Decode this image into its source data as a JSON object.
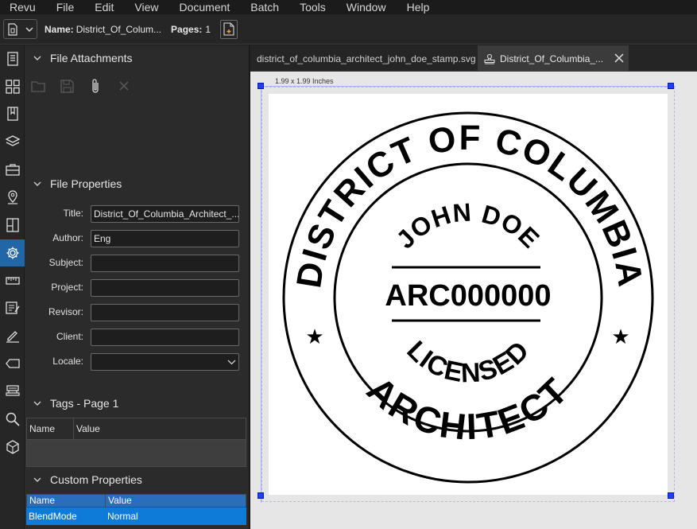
{
  "menu": [
    "Revu",
    "File",
    "Edit",
    "View",
    "Document",
    "Batch",
    "Tools",
    "Window",
    "Help"
  ],
  "toolbar": {
    "name_label": "Name:",
    "name_value": "District_Of_Colum...",
    "pages_label": "Pages:",
    "pages_value": "1"
  },
  "rail_icons": [
    "thumbnails-icon",
    "grid-icon",
    "bookmarks-icon",
    "layers-icon",
    "toolchest-icon",
    "places-icon",
    "measure-icon",
    "properties-icon",
    "ruler-icon",
    "markups-list-icon",
    "signature-icon",
    "tag-icon",
    "stamp-icon",
    "search-icon",
    "3d-icon"
  ],
  "file_attachments": {
    "title": "File Attachments",
    "tools": [
      "folder-icon",
      "save-icon",
      "attach-icon",
      "close-icon"
    ]
  },
  "file_properties": {
    "title": "File Properties",
    "fields": [
      {
        "label": "Title:",
        "value": "District_Of_Columbia_Architect_..."
      },
      {
        "label": "Author:",
        "value": "Eng"
      },
      {
        "label": "Subject:",
        "value": ""
      },
      {
        "label": "Project:",
        "value": ""
      },
      {
        "label": "Revisor:",
        "value": ""
      },
      {
        "label": "Client:",
        "value": ""
      },
      {
        "label": "Locale:",
        "value": ""
      }
    ]
  },
  "tags": {
    "title": "Tags - Page 1",
    "columns": [
      "Name",
      "Value"
    ]
  },
  "custom_properties": {
    "title": "Custom Properties",
    "columns": [
      "Name",
      "Value"
    ],
    "rows": [
      {
        "name": "BlendMode",
        "value": "Normal"
      }
    ]
  },
  "tabs": [
    {
      "label": "district_of_columbia_architect_john_doe_stamp.svg",
      "active": false
    },
    {
      "label": "District_Of_Columbia_...",
      "active": true
    }
  ],
  "page": {
    "size_label": "1.99 x 1.99 Inches"
  },
  "stamp": {
    "top_arc": "DISTRICT OF COLUMBIA",
    "name": "JOHN DOE",
    "number": "ARC000000",
    "licensed": "LICENSED",
    "bottom_arc": "ARCHITECT",
    "star": "★"
  },
  "colors": {
    "accent": "#2166a6",
    "selection": "#0f7bd9",
    "handle": "#1f3cff"
  }
}
